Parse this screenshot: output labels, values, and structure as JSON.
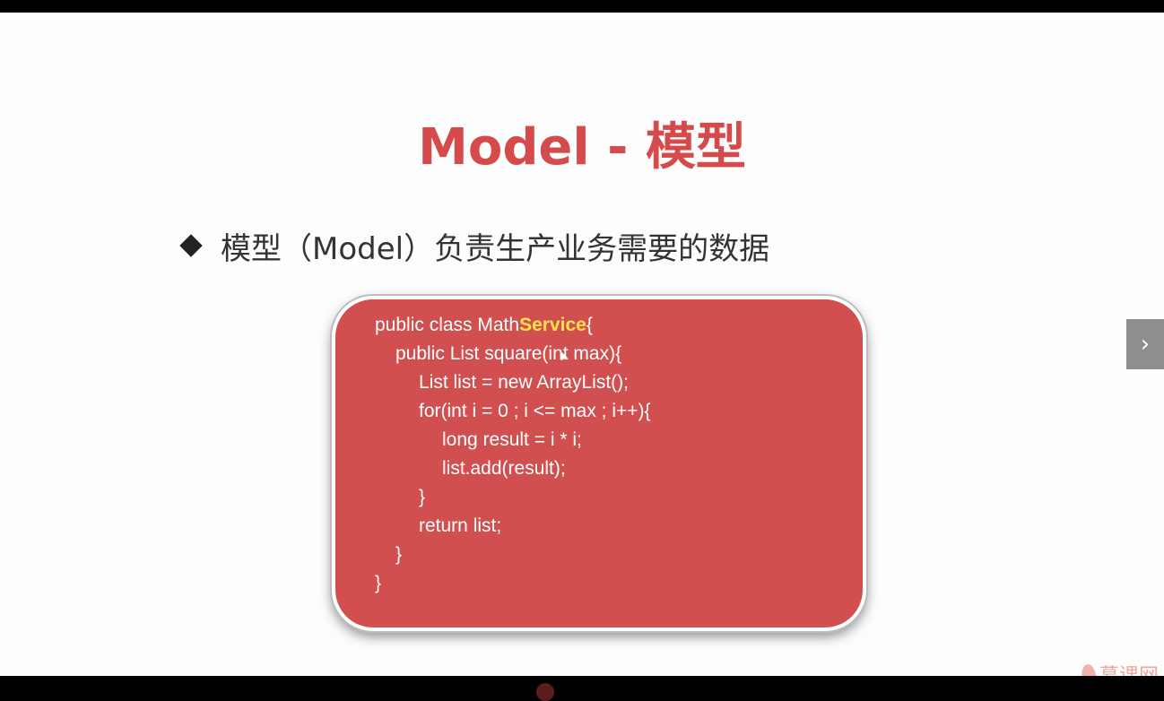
{
  "slide": {
    "title": "Model - 模型",
    "bullet": {
      "text": "模型（Model）负责生产业务需要的数据",
      "icon": "diamond-bullet-icon"
    },
    "code": {
      "line1_prefix": "public class Math",
      "line1_highlight": "Service",
      "line1_suffix": "{",
      "line2": "public List square(int max){",
      "line3": "List list = new ArrayList();",
      "line4": "for(int i = 0 ; i <= max ; i++){",
      "line5": "long result = i * i;",
      "line6": "list.add(result);",
      "line7": "}",
      "line8": "return list;",
      "line9": "}",
      "line10": "}"
    },
    "colors": {
      "title": "#d54a4a",
      "code_background": "#d24f50",
      "highlight": "#ffe14d"
    }
  },
  "controls": {
    "next_button_icon": "chevron-right-icon",
    "next_button_label": "›"
  },
  "watermark": {
    "text": "慕课网",
    "icon": "flame-icon"
  }
}
